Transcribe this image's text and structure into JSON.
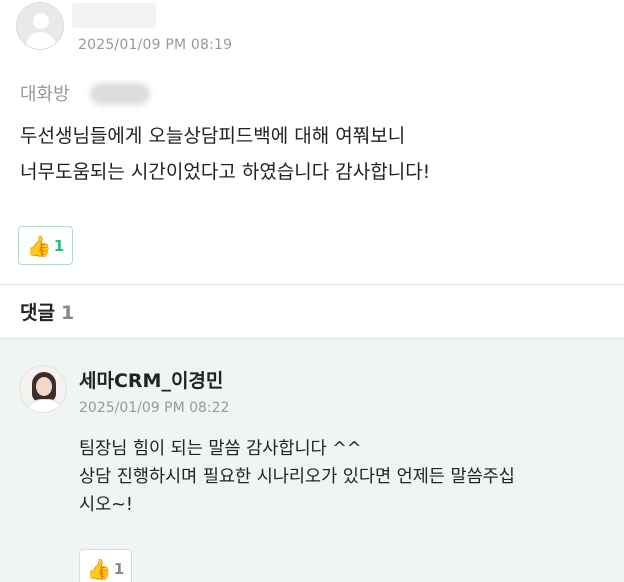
{
  "post": {
    "date": "2025/01/09 PM 08:19",
    "chatroom_label": "대화방",
    "body_lines": [
      "두선생님들에게 오늘상담피드백에 대해 여쭤보니",
      "너무도움되는 시간이었다고 하였습니다 감사합니다!"
    ],
    "like_count": "1",
    "like_icon": "thumbs-up-icon"
  },
  "comments": {
    "title": "댓글",
    "count": "1",
    "items": [
      {
        "author": "세마CRM_이경민",
        "date": "2025/01/09 PM 08:22",
        "body_lines": [
          "팀장님 힘이 되는 말씀 감사합니다 ^^",
          "상담 진행하시며 필요한 시나리오가 있다면 언제든 말씀주십",
          "시오~!"
        ],
        "like_count": "1"
      }
    ]
  },
  "colors": {
    "accent_green": "#1ec27a",
    "comment_bg": "#eef5f2",
    "muted_text": "#999999"
  }
}
